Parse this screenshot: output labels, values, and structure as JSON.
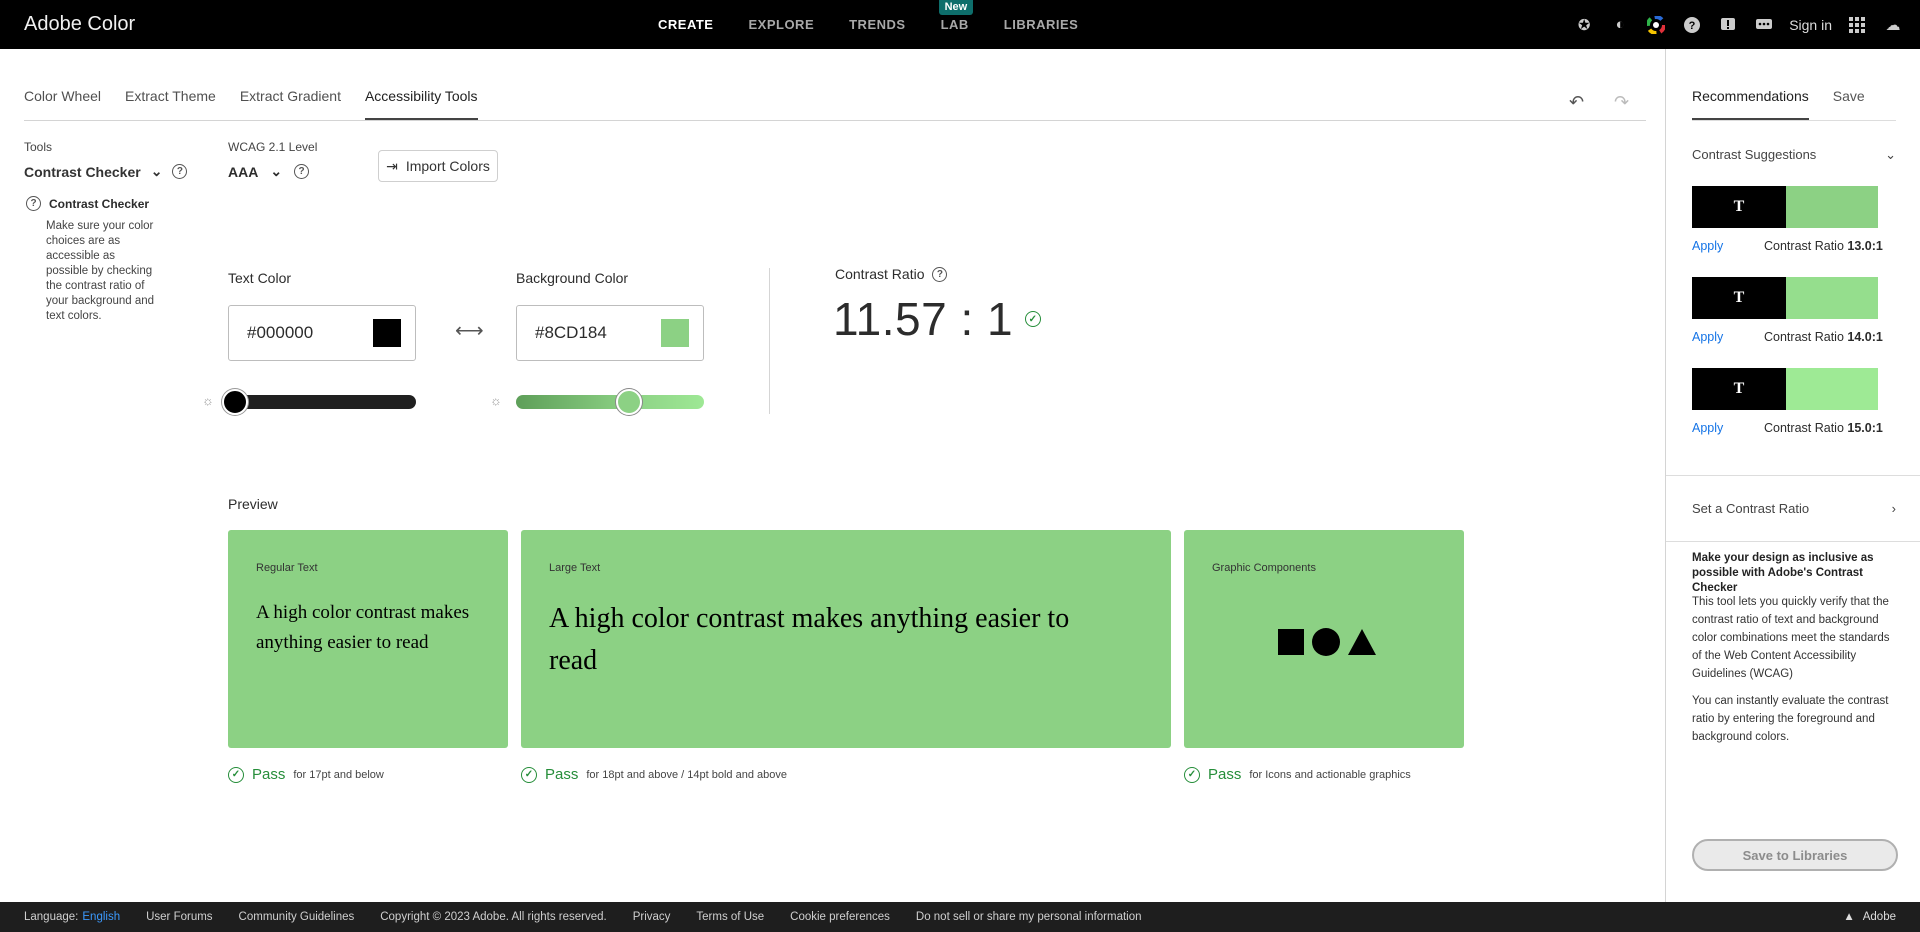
{
  "app": {
    "title": "Adobe Color"
  },
  "nav": {
    "items": [
      "CREATE",
      "EXPLORE",
      "TRENDS",
      "LAB",
      "LIBRARIES"
    ],
    "lab_badge": "New",
    "sign_in": "Sign in"
  },
  "tabs": [
    "Color Wheel",
    "Extract Theme",
    "Extract Gradient",
    "Accessibility Tools"
  ],
  "tools": {
    "label": "Tools",
    "selected": "Contrast Checker",
    "info_title": "Contrast Checker",
    "info_text": "Make sure your color choices are as accessible as possible by checking the contrast ratio of your background and text colors."
  },
  "wcag": {
    "label": "WCAG 2.1 Level",
    "selected": "AAA"
  },
  "import_button": "Import Colors",
  "text_color": {
    "label": "Text Color",
    "value": "#000000",
    "swatch": "#000000",
    "slider_level": 0.0
  },
  "background_color": {
    "label": "Background Color",
    "value": "#8CD184",
    "swatch": "#8CD184",
    "slider_level": 0.6
  },
  "contrast": {
    "label": "Contrast Ratio",
    "value": "11.57 : 1"
  },
  "preview": {
    "label": "Preview",
    "regular": {
      "label": "Regular Text",
      "text": "A high color contrast makes anything easier to read",
      "pass": "Pass",
      "desc": "for 17pt and below"
    },
    "large": {
      "label": "Large Text",
      "text": "A high color contrast makes anything easier to read",
      "pass": "Pass",
      "desc": "for 18pt and above / 14pt bold and above"
    },
    "graphic": {
      "label": "Graphic Components",
      "pass": "Pass",
      "desc": "for Icons and actionable graphics"
    }
  },
  "right_panel": {
    "tabs": [
      "Recommendations",
      "Save"
    ],
    "suggestions_title": "Contrast Suggestions",
    "suggestions": [
      {
        "glyph": "T",
        "color": "#8CD184",
        "apply": "Apply",
        "ratio_label": "Contrast Ratio",
        "ratio": "13.0:1"
      },
      {
        "glyph": "T",
        "color": "#95DE8D",
        "apply": "Apply",
        "ratio_label": "Contrast Ratio",
        "ratio": "14.0:1"
      },
      {
        "glyph": "T",
        "color": "#9EEA95",
        "apply": "Apply",
        "ratio_label": "Contrast Ratio",
        "ratio": "15.0:1"
      }
    ],
    "set_ratio": "Set a Contrast Ratio",
    "promo_title": "Make your design as inclusive as possible with Adobe's Contrast Checker",
    "promo_p1": "This tool lets you quickly verify that the contrast ratio of text and background color combinations meet the standards of the Web Content Accessibility Guidelines (WCAG)",
    "promo_p2": "You can instantly evaluate the contrast ratio by entering the foreground and background colors.",
    "save_button": "Save to Libraries"
  },
  "footer": {
    "language_label": "Language:",
    "language": "English",
    "links": [
      "User Forums",
      "Community Guidelines",
      "Copyright © 2023 Adobe. All rights reserved.",
      "Privacy",
      "Terms of Use",
      "Cookie preferences",
      "Do not sell or share my personal information"
    ],
    "brand": "Adobe"
  }
}
